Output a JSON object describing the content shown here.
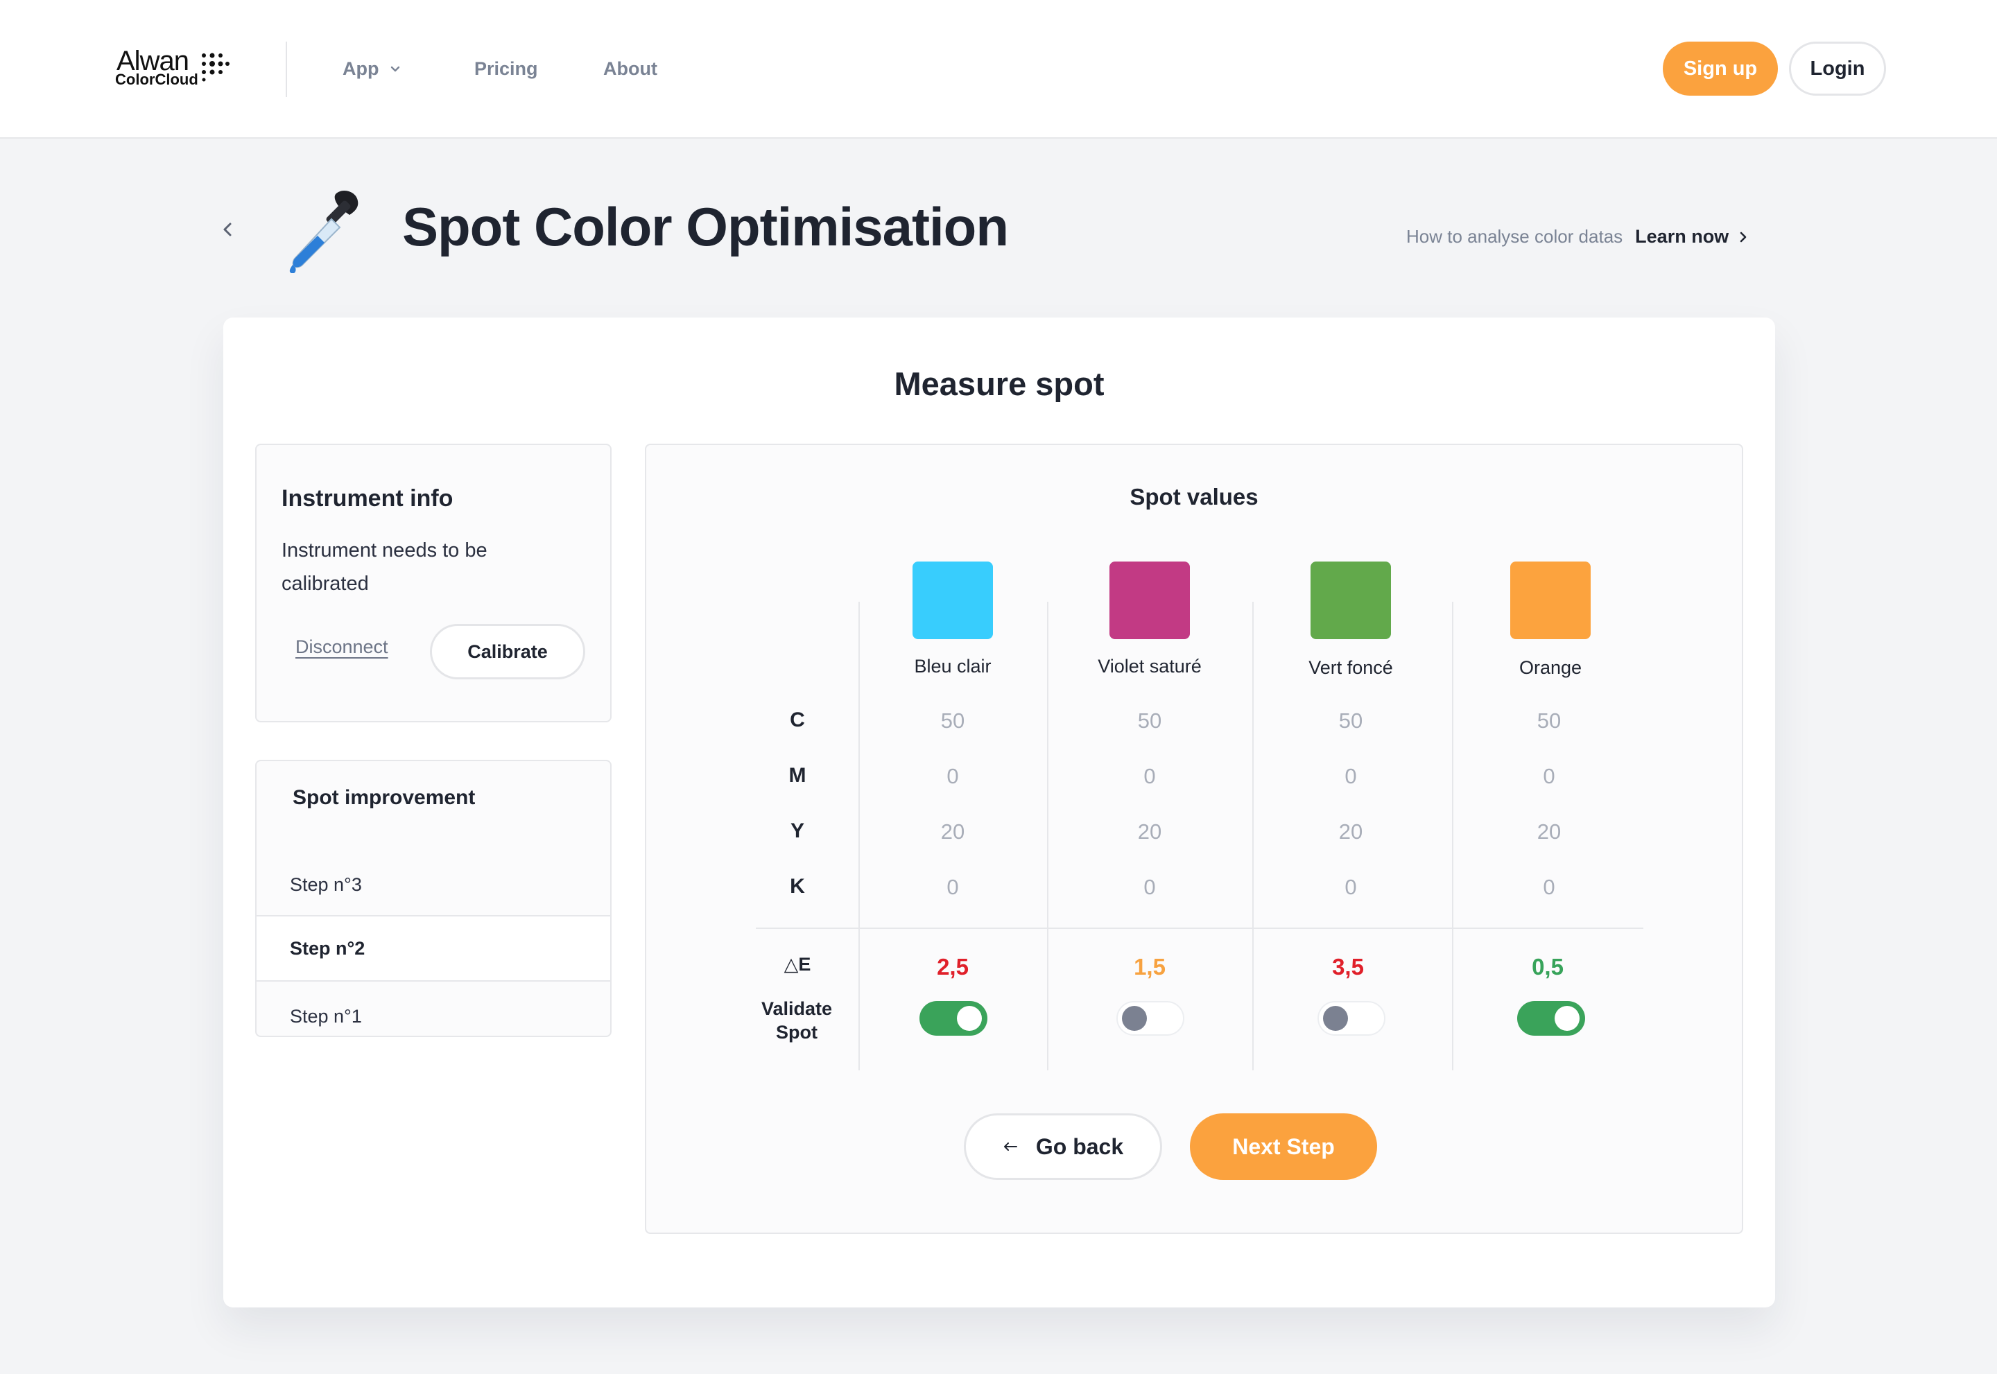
{
  "nav": {
    "logo_main": "Alwan",
    "logo_sub": "ColorCloud",
    "links": [
      {
        "label": "App",
        "has_dropdown": true
      },
      {
        "label": "Pricing"
      },
      {
        "label": "About"
      }
    ],
    "signup_label": "Sign up",
    "login_label": "Login"
  },
  "header": {
    "title": "Spot Color Optimisation",
    "icon": "dropper-icon",
    "learn_hint": "How to analyse color datas",
    "learn_link": "Learn now"
  },
  "card": {
    "title": "Measure spot"
  },
  "instrument": {
    "title": "Instrument info",
    "message": "Instrument needs to be calibrated",
    "disconnect_label": "Disconnect",
    "calibrate_label": "Calibrate"
  },
  "improvement": {
    "title": "Spot improvement",
    "steps": [
      {
        "label": "Step n°3",
        "active": false
      },
      {
        "label": "Step n°2",
        "active": true
      },
      {
        "label": "Step n°1",
        "active": false
      }
    ]
  },
  "spot_values": {
    "title": "Spot values",
    "row_labels": [
      "C",
      "M",
      "Y",
      "K"
    ],
    "delta_label": "△E",
    "validate_label": "Validate Spot",
    "spots": [
      {
        "name": "Bleu clair",
        "color": "#38cdfd",
        "cmyk": [
          "50",
          "0",
          "20",
          "0"
        ],
        "delta_e": "2,5",
        "delta_color": "#e0202a",
        "validated": true
      },
      {
        "name": "Violet saturé",
        "color": "#c23a84",
        "cmyk": [
          "50",
          "0",
          "20",
          "0"
        ],
        "delta_e": "1,5",
        "delta_color": "#f7a240",
        "validated": false
      },
      {
        "name": "Vert foncé",
        "color": "#62a94b",
        "cmyk": [
          "50",
          "0",
          "20",
          "0"
        ],
        "delta_e": "3,5",
        "delta_color": "#e0202a",
        "validated": false
      },
      {
        "name": "Orange",
        "color": "#fca33e",
        "cmyk": [
          "50",
          "0",
          "20",
          "0"
        ],
        "delta_e": "0,5",
        "delta_color": "#37a35a",
        "validated": true
      }
    ]
  },
  "actions": {
    "go_back_label": "Go back",
    "next_label": "Next Step"
  },
  "colors": {
    "accent": "#fba23e",
    "toggle_on": "#3aa35a"
  }
}
